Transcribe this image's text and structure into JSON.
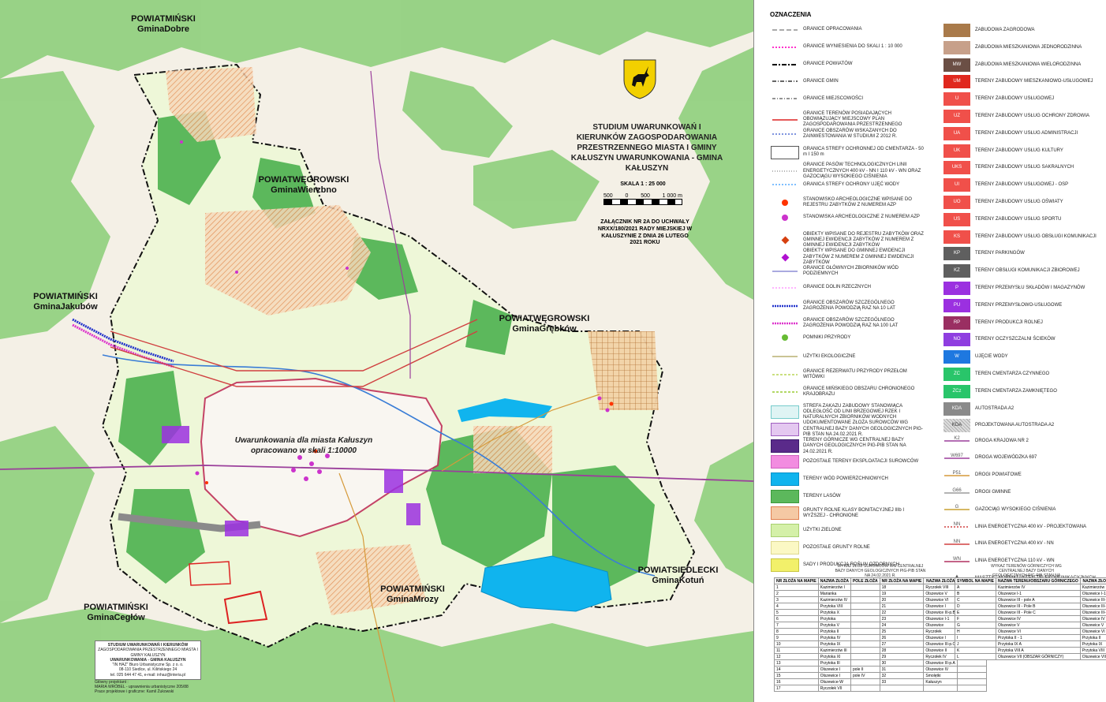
{
  "map": {
    "title": "STUDIUM UWARUNKOWAŃ I KIERUNKÓW ZAGOSPODAROWANIA PRZESTRZENNEGO MIASTA I GMINY KAŁUSZYN UWARUNKOWANIA - GMINA KAŁUSZYN",
    "scale_label": "SKALA 1 : 25 000",
    "scale_ticks": [
      "500",
      "0",
      "500",
      "1 000 m"
    ],
    "annex": "ZAŁĄCZNIK NR 2A DO UCHWAŁY NRXX/180/2021 RADY MIEJSKIEJ W KAŁUSZYNIE Z DNIA 26 LUTEGO 2021 ROKU",
    "city_note": "Uwarunkowania dla miasta Kałuszyn opracowano w skali 1:10000",
    "region_labels": [
      {
        "id": "dobre",
        "line1": "POWIATMIŃSKI",
        "line2": "GminaDobre"
      },
      {
        "id": "wierzbno",
        "line1": "POWIATWĘGROWSKI",
        "line2": "GminaWierzbno"
      },
      {
        "id": "jakubow",
        "line1": "POWIATMIŃSKI",
        "line2": "GminaJakubów"
      },
      {
        "id": "grebkow",
        "line1": "POWIATWĘGROWSKI",
        "line2": "GminaGrębków"
      },
      {
        "id": "mrozy",
        "line1": "POWIATMIŃSKI",
        "line2": "GminaMrozy"
      },
      {
        "id": "kotun",
        "line1": "POWIATSIEDLECKI",
        "line2": "GminaKotuń"
      },
      {
        "id": "ceglow",
        "line1": "POWIATMIŃSKI",
        "line2": "GminaCegłów"
      }
    ],
    "credits": [
      "STUDIUM UWARUNKOWAŃ I KIERUNKÓW",
      "ZAGOSPODAROWANIA PRZESTRZENNEGO MIASTA I GMINY KAŁUSZYN",
      "UWARUNKOWANIA - GMINA KAŁUSZYN",
      "\"IN HAZ\" Biuro Urbanistyczne Sp. z o. o.",
      "08-110 Siedlce, ul. Kilińskiego 24",
      "tel. 025 644 47 41, e-mail: inhaz@interia.pl",
      "Główny projektant :",
      "MARIA WRÓBEL - uprawnienia urbanistyczne 205/88",
      "Prace projektowe i graficzne: Kamil Żukowski"
    ]
  },
  "legend": {
    "heading": "OZNACZENIA",
    "left": [
      {
        "sym": "line",
        "color": "#777",
        "dash": "6,3",
        "text": "GRANICE OPRACOWANIA"
      },
      {
        "sym": "line",
        "color": "#ff33cc",
        "dash": "2,2",
        "w": 2,
        "text": "GRANICE WYNIESIENIA DO SKALI 1 : 10 000"
      },
      {
        "sym": "line",
        "color": "#000",
        "dash": "6,2,2,2",
        "w": 2,
        "text": "GRANICE POWIATÓW"
      },
      {
        "sym": "line",
        "color": "#333",
        "dash": "5,2,1,2",
        "w": 1.5,
        "text": "GRANICE GMIN"
      },
      {
        "sym": "line",
        "color": "#555",
        "dash": "4,2,1,2",
        "text": "GRANICE MIEJSCOWOŚCI"
      },
      {
        "sym": "line",
        "color": "#d22",
        "w": 1.5,
        "text": "GRANICE TERENÓW POSIADAJĄCYCH OBOWIĄZUJĄCY MIEJSCOWY PLAN ZAGOSPODAROWANIA PRZESTRZENNEGO"
      },
      {
        "sym": "line",
        "color": "#3355cc",
        "dash": "2,2",
        "text": "GRANICE OBSZARÓW WSKAZANYCH DO ZAINWESTOWANIA W STUDIUM Z 2012 R."
      },
      {
        "sym": "box",
        "fill": "#ffffff",
        "stroke": "#555",
        "text": "GRANICA STREFY OCHRONNEJ OD CMENTARZA - 50 m I 150 m"
      },
      {
        "sym": "line",
        "color": "#888",
        "dash": "1,2",
        "text": "GRANICE PASÓW TECHNOLOGICZNYCH LINII ENERGETYCZNYCH 400 kV - NN I 110 kV - WN ORAZ GAZOCIĄGU WYSOKIEGO CIŚNIENIA"
      },
      {
        "sym": "line",
        "color": "#3399ff",
        "dash": "2,2",
        "text": "GRANICA STREFY OCHRONY UJĘĆ WODY"
      },
      {
        "sym": "dot",
        "color": "#ff3300",
        "text": "STANOWISKO ARCHEOLOGICZNE WPISANE DO REJESTRU ZABYTKÓW Z NUMEREM AZP"
      },
      {
        "sym": "dot",
        "color": "#cc33cc",
        "text": "STANOWISKA ARCHEOLOGICZNE Z NUMEREM AZP"
      },
      {
        "sym": "diamond",
        "color": "#d64010",
        "text": "OBIEKTY WPISANE DO REJESTRU ZABYTKÓW ORAZ GMINNEJ EWIDENCJI ZABYTKÓW Z NUMEREM Z GMINNEJ EWIDENCJI ZABYTKÓW"
      },
      {
        "sym": "diamond",
        "color": "#b010d0",
        "text": "OBIEKTY WPISANE DO GMINNEJ EWIDENCJI ZABYTKÓW Z NUMEREM Z GMINNEJ EWIDENCJI ZABYTKÓW"
      },
      {
        "sym": "line",
        "color": "#7777cc",
        "text": "GRANICE GŁÓWNYCH ZBIORNIKÓW WÓD PODZIEMNYCH"
      },
      {
        "sym": "line",
        "color": "#ff88ff",
        "dash": "2,2",
        "text": "GRANICE DOLIN RZECZNYCH"
      },
      {
        "sym": "line",
        "color": "#2233cc",
        "dash": "2,1",
        "w": 2.5,
        "text": "GRANICE OBSZARÓW SZCZEGÓLNEGO ZAGROŻENIA POWODZIĄ RAZ NA 10 LAT"
      },
      {
        "sym": "line",
        "color": "#dd33cc",
        "dash": "2,1",
        "w": 2.5,
        "text": "GRANICE OBSZARÓW SZCZEGÓLNEGO ZAGROŻENIA POWODZIĄ RAZ NA 100 LAT"
      },
      {
        "sym": "dot",
        "color": "#66bb33",
        "text": "POMNIKI PRZYRODY"
      },
      {
        "sym": "line",
        "color": "#aaa055",
        "text": "UŻYTKI EKOLOGICZNE"
      },
      {
        "sym": "line",
        "color": "#aacc33",
        "dash": "3,2",
        "text": "GRANICE REZERWATU PRZYRODY PRZEŁOM WITÓWKI"
      },
      {
        "sym": "line",
        "color": "#99cc33",
        "dash": "3,2",
        "w": 1.5,
        "text": "GRANICE MIŃSKIEGO OBSZARU CHRONIONEGO KRAJOBRAZU"
      },
      {
        "sym": "box",
        "fill": "#dff4f4",
        "stroke": "#7cc",
        "text": "STREFA ZAKAZU ZABUDOWY STANOWIĄCA ODLEGŁOŚĆ OD LINII BRZEGOWEJ RZEK I NATURALNYCH ZBIORNIKÓW WODNYCH"
      },
      {
        "sym": "box",
        "fill": "#e4c8f0",
        "stroke": "#a060c0",
        "text": "UDOKUMENTOWANE ZŁOŻA SUROWCÓW WG CENTRALNEJ BAZY DANYCH GEOLOGICZNYCH PIG-PIB STAN NA 24.02.2021 R."
      },
      {
        "sym": "box",
        "fill": "#5a2a8a",
        "stroke": "#3a1a6a",
        "text": "TERENY GÓRNICZE WG CENTRALNEJ BAZY DANYCH GEOLOGICZNYCH PIG-PIB STAN NA 24.02.2021 R."
      },
      {
        "sym": "box",
        "fill": "#f28ce0",
        "stroke": "#d060c0",
        "text": "POZOSTAŁE TERENY EKSPLOATACJI SUROWCÓW"
      },
      {
        "sym": "box",
        "fill": "#10b4ee",
        "stroke": "#0890c8",
        "text": "TERENY WÓD POWIERZCHNIOWYCH"
      },
      {
        "sym": "box",
        "fill": "#5cb85c",
        "stroke": "#3c9a3c",
        "text": "TERENY LASÓW"
      },
      {
        "sym": "box",
        "fill": "#f5c9a4",
        "stroke": "#e08050",
        "text": "GRUNTY ROLNE KLASY BONITACYJNEJ IIIb I WYŻSZEJ - CHRONIONE"
      },
      {
        "sym": "box",
        "fill": "#d4f0a8",
        "stroke": "#a8d070",
        "text": "UŻYTKI ZIELONE"
      },
      {
        "sym": "box",
        "fill": "#fbf8c4",
        "stroke": "#ddd890",
        "text": "POZOSTAŁE GRUNTY ROLNE"
      },
      {
        "sym": "box",
        "fill": "#f2f06a",
        "stroke": "#c8c640",
        "text": "SADY I PRODUKCJA ROŚLIN OZDOBNYCH"
      }
    ],
    "right": [
      {
        "code": "",
        "color": "#a97a4a",
        "text": "ZABUDOWA ZAGRODOWA"
      },
      {
        "code": "",
        "color": "#c7a08a",
        "text": "ZABUDOWA MIESZKANIOWA JEDNORODZINNA"
      },
      {
        "code": "MW",
        "color": "#6b4f45",
        "text": "ZABUDOWA MIESZKANIOWA WIELORODZINNA"
      },
      {
        "code": "UM",
        "color": "#e0281e",
        "text": "TERENY ZABUDOWY MIESZKANIOWO-USŁUGOWEJ"
      },
      {
        "code": "U",
        "color": "#f0504a",
        "text": "TERENY ZABUDOWY USŁUGOWEJ"
      },
      {
        "code": "UZ",
        "color": "#f0504a",
        "text": "TERENY ZABUDOWY USŁUG OCHRONY ZDROWIA"
      },
      {
        "code": "UA",
        "color": "#f0504a",
        "text": "TERENY ZABUDOWY USŁUG ADMINISTRACJI"
      },
      {
        "code": "UK",
        "color": "#f0504a",
        "text": "TERENY ZABUDOWY USŁUG KULTURY"
      },
      {
        "code": "UKS",
        "color": "#f0504a",
        "text": "TERENY ZABUDOWY USŁUG SAKRALNYCH"
      },
      {
        "code": "UI",
        "color": "#f0504a",
        "text": "TERENY ZABUDOWY USŁUGOWEJ - OSP"
      },
      {
        "code": "UO",
        "color": "#f0504a",
        "text": "TERENY ZABUDOWY USŁUG OŚWIATY"
      },
      {
        "code": "US",
        "color": "#f0504a",
        "text": "TERENY ZABUDOWY USŁUG SPORTU"
      },
      {
        "code": "KS",
        "color": "#f0504a",
        "text": "TERENY ZABUDOWY USŁUG OBSŁUGI KOMUNIKACJI"
      },
      {
        "code": "KP",
        "color": "#5f5f5f",
        "text": "TERENY PARKINGÓW"
      },
      {
        "code": "KZ",
        "color": "#5f5f5f",
        "text": "TERENY OBSŁUGI KOMUNIKACJI ZBIOROWEJ"
      },
      {
        "code": "P",
        "color": "#9b30e0",
        "text": "TERENY PRZEMYSŁU SKŁADÓW I MAGAZYNÓW"
      },
      {
        "code": "PU",
        "color": "#9b30e0",
        "text": "TERENY PRZEMYSŁOWO-USŁUGOWE"
      },
      {
        "code": "RP",
        "color": "#9a2f62",
        "text": "TERENY PRODUKCJI ROLNEJ"
      },
      {
        "code": "NO",
        "color": "#8f3ee0",
        "text": "TERENY OCZYSZCZALNI ŚCIEKÓW"
      },
      {
        "code": "W",
        "color": "#1e78e0",
        "text": "UJĘCIE WODY"
      },
      {
        "code": "ZC",
        "color": "#29c56a",
        "text": "TEREN CMENTARZA CZYNNEGO"
      },
      {
        "code": "ZCz",
        "color": "#29c56a",
        "text": "TEREN CMENTARZA ZAMKNIĘTEGO"
      },
      {
        "code": "KDA",
        "color": "#8a8a8a",
        "text": "AUTOSTRADA A2"
      },
      {
        "code": "KDA",
        "color": "#d8d8d8",
        "hatch": true,
        "text": "PROJEKTOWANA AUTOSTRADA A2"
      },
      {
        "code": "K2",
        "line": "#9b3f9b",
        "text": "DROGA KRAJOWA NR 2"
      },
      {
        "code": "W697",
        "line": "#9b3f9b",
        "text": "DROGA WOJEWÓDZKA 697"
      },
      {
        "code": "P51",
        "line": "#d69a3a",
        "text": "DROGI POWIATOWE"
      },
      {
        "code": "G66",
        "line": "#9c9c9c",
        "text": "DROGI GMINNE"
      },
      {
        "code": "G",
        "line": "#c8a030",
        "text": "GAZOCIĄG WYSOKIEGO CIŚNIENIA"
      },
      {
        "code": "NN",
        "line": "#d04040",
        "dash": "2,2",
        "text": "LINIA ENERGETYCZNA 400 kV - PROJEKTOWANA"
      },
      {
        "code": "NN",
        "line": "#d04040",
        "text": "LINIA ENERGETYCZNA 400 kV - NN"
      },
      {
        "code": "WN",
        "line": "#b03060",
        "text": "LINIA ENERGETYCZNA 110 kV - WN"
      },
      {
        "code": "▲",
        "line": "",
        "text": "MASZTY - NOŚNIKI ANTEN TELEKOMUNIKACYJNYCH"
      }
    ],
    "table1": {
      "caption": "WYKAZ ZŁÓŻ SUROWCÓW WG CENTRALNEJ BAZY DANYCH GEOLOGICZNYCH PIG-PIB STAN NA 24.02.2021 R.",
      "headers": [
        "NR ZŁOŻA NA MAPIE",
        "NAZWA ZŁOŻA",
        "POLE ZŁOŻA",
        "NR ZŁOŻA NA MAPIE",
        "NAZWA ZŁOŻA",
        "POLE ZŁOŻA"
      ],
      "rows": [
        [
          "1",
          "Kazimierzów I",
          "",
          "18",
          "Ryczołek VIII",
          ""
        ],
        [
          "2",
          "Marianka",
          "",
          "19",
          "Olszewice V",
          ""
        ],
        [
          "3",
          "Kazimierzów IV",
          "",
          "20",
          "Olszewice VI",
          ""
        ],
        [
          "4",
          "Przytoka VIII",
          "",
          "21",
          "Olszewice I",
          "pole I"
        ],
        [
          "5",
          "Przytoka X",
          "",
          "22",
          "Olszewice III-p.B",
          ""
        ],
        [
          "6",
          "Przytoka",
          "",
          "23",
          "Olszewice I-1",
          ""
        ],
        [
          "7",
          "Przytoka V",
          "",
          "24",
          "Olszewice",
          ""
        ],
        [
          "8",
          "Przytoka II",
          "",
          "25",
          "Ryczołek",
          ""
        ],
        [
          "9",
          "Przytoka IV",
          "",
          "26",
          "Olszewice I",
          "pole III"
        ],
        [
          "10",
          "Przytoka IX",
          "",
          "27",
          "Olszewice III-p.C",
          ""
        ],
        [
          "11",
          "Kazimierzów III",
          "",
          "28",
          "Olszewice II",
          ""
        ],
        [
          "12",
          "Przytoka XI",
          "",
          "29",
          "Ryczołek IV",
          ""
        ],
        [
          "13",
          "Przytoka III",
          "",
          "30",
          "Olszewice III-p.A",
          ""
        ],
        [
          "14",
          "Olszewice I",
          "pole II",
          "31",
          "Olszewice IV",
          ""
        ],
        [
          "15",
          "Olszewice I",
          "pole IV",
          "32",
          "Smolętki",
          ""
        ],
        [
          "16",
          "Olszewice-W",
          "",
          "33",
          "Kałuszyn",
          ""
        ],
        [
          "17",
          "Ryczołek VII",
          "",
          "",
          "",
          ""
        ]
      ]
    },
    "table2": {
      "caption": "WYKAZ TERENÓW GÓRNICZYCH WG CENTRALNEJ BAZY DANYCH GEOLOGICZNYCH PIG-PIB STAN NA 24.02.2021 R.",
      "headers": [
        "SYMBOL NA MAPIE",
        "NAZWA TERENU/OBSZARU GÓRNICZEGO",
        "NAZWA ZŁOŻA"
      ],
      "rows": [
        [
          "A",
          "Kazimierzów IV",
          "Kazimierzów IV"
        ],
        [
          "B",
          "Olszewice I-1",
          "Olszewice I-1"
        ],
        [
          "C",
          "Olszewice III - pole A",
          "Olszewice III-p.A"
        ],
        [
          "D",
          "Olszewice III - Pole B",
          "Olszewice III-p.B"
        ],
        [
          "E",
          "Olszewice III - Pole C",
          "Olszewice III-p.C"
        ],
        [
          "F",
          "Olszewice IV",
          "Olszewice IV"
        ],
        [
          "G",
          "Olszewice V",
          "Olszewice V"
        ],
        [
          "H",
          "Olszewice VI",
          "Olszewice VI"
        ],
        [
          "I",
          "Przytoka II - 1",
          "Przytoka II"
        ],
        [
          "J",
          "Przytoka IX A",
          "Przytoka IX"
        ],
        [
          "K",
          "Przytoka VIII A",
          "Przytoka VIII"
        ],
        [
          "L",
          "Olszewice VII (OBSZAR GÓRNICZY)",
          "Olszewice VII"
        ]
      ]
    }
  }
}
